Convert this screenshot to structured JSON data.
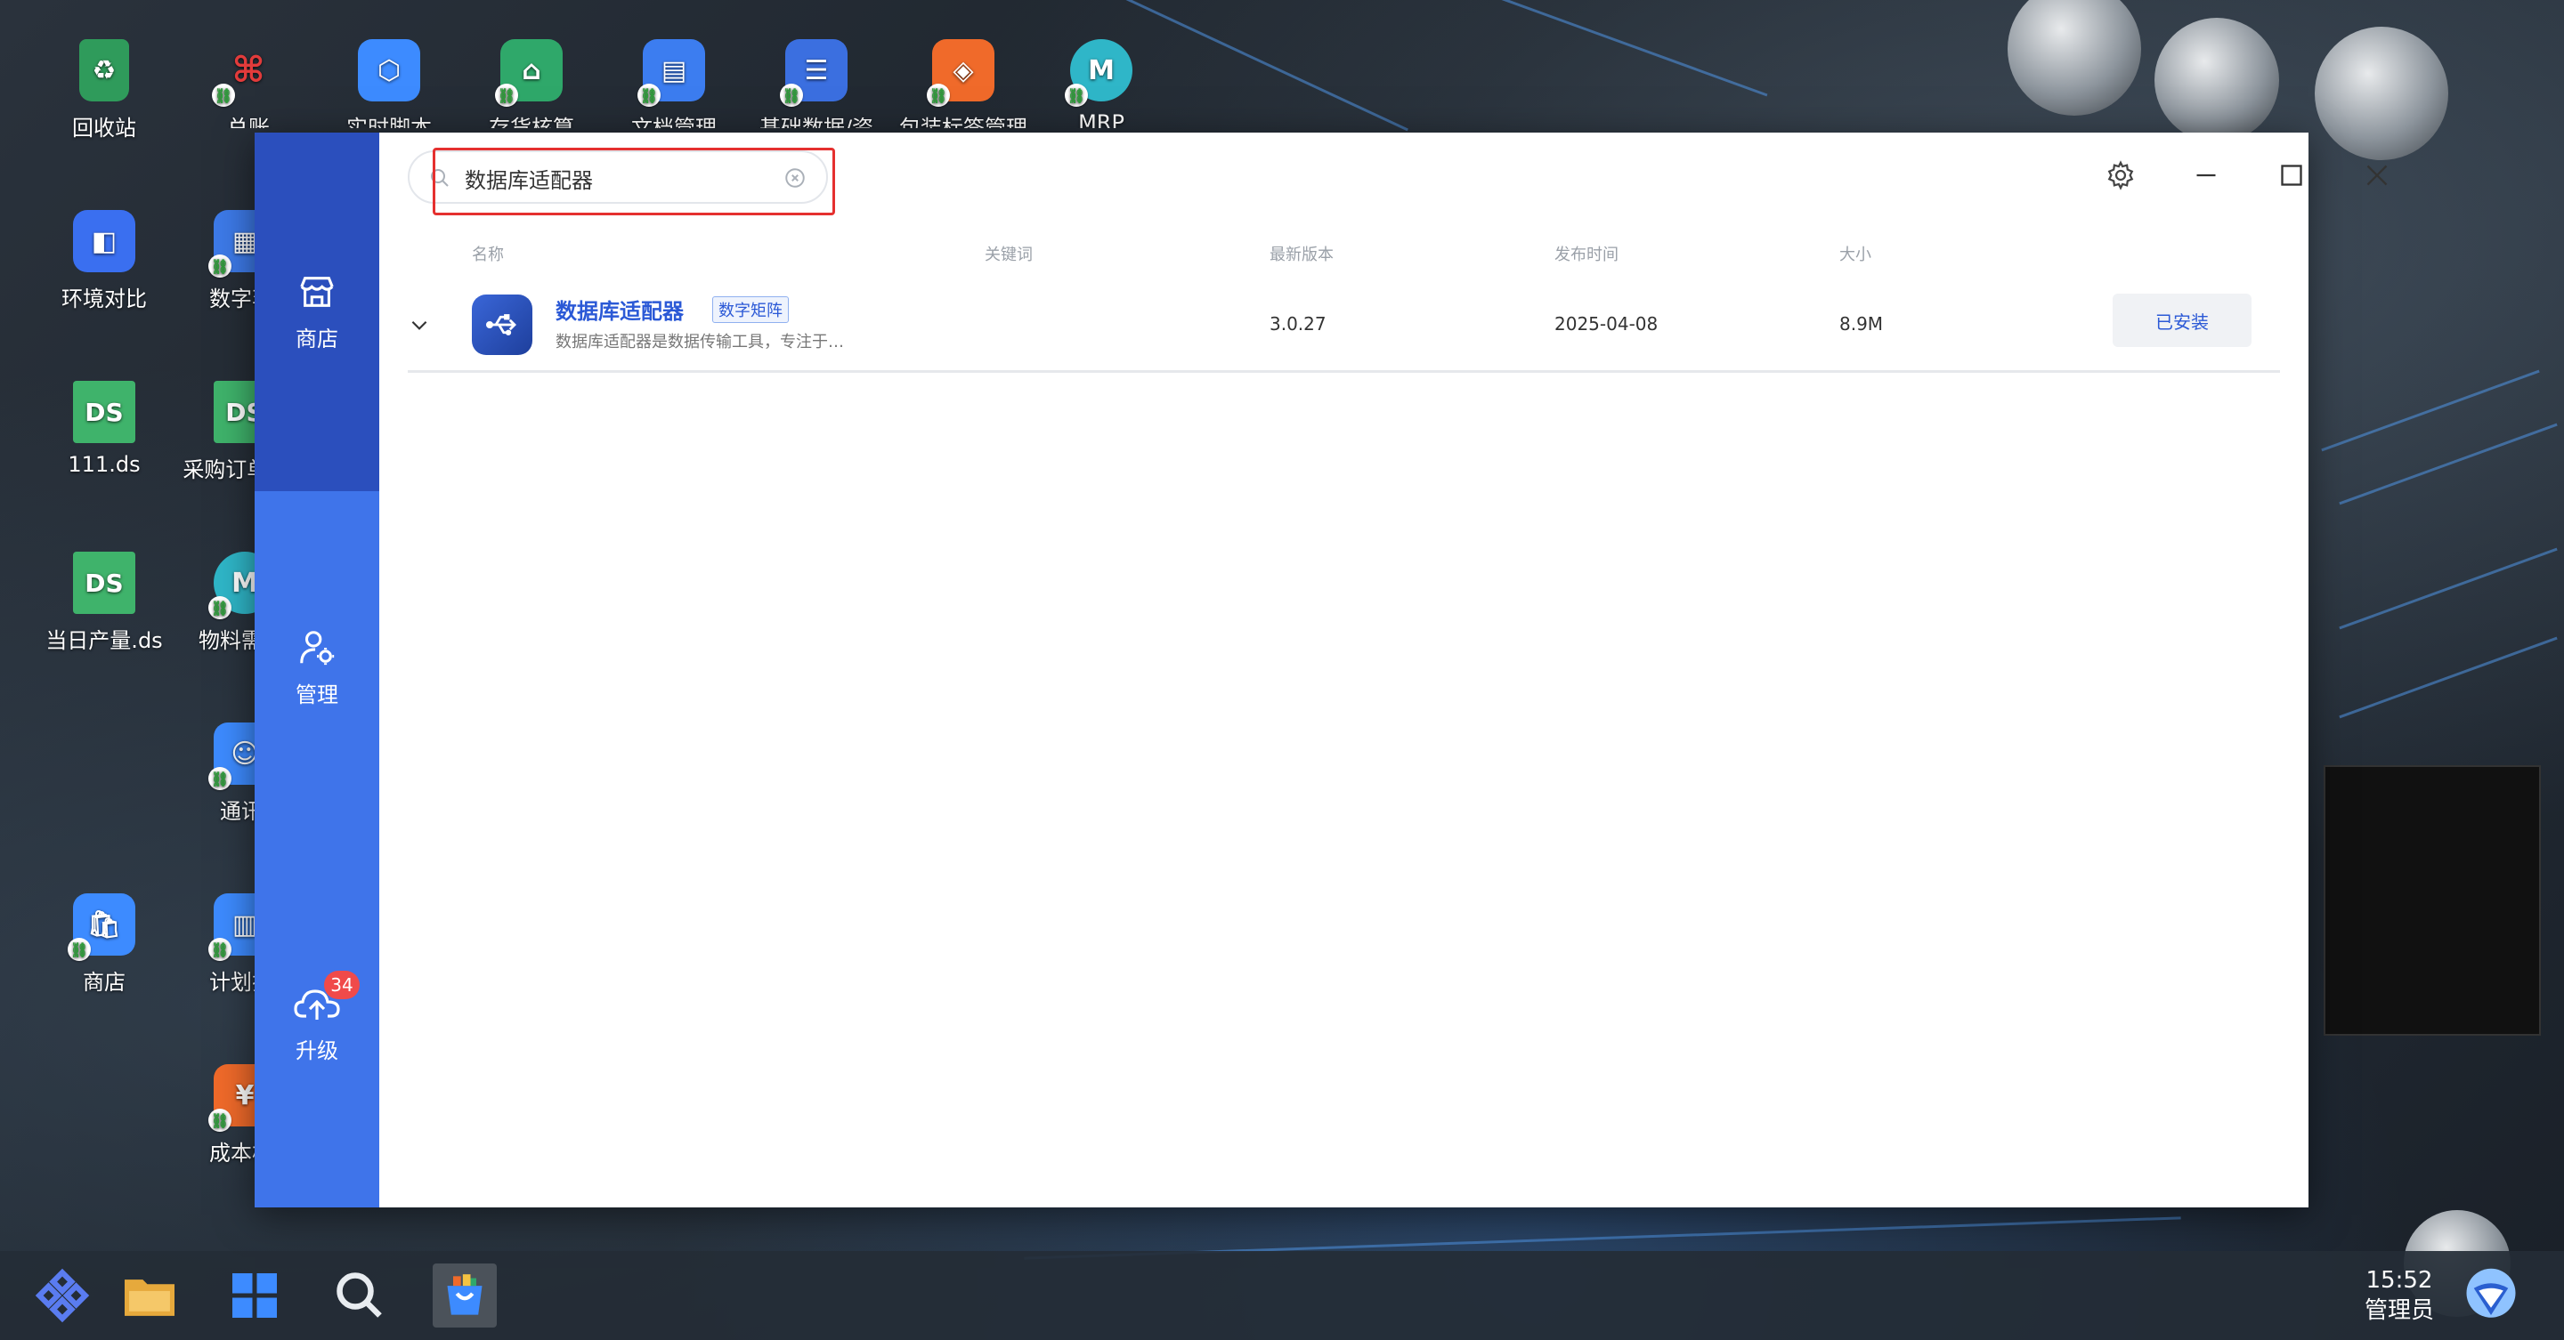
{
  "desktop": {
    "icons": [
      {
        "label": "回收站",
        "icon": "recycle-bin-icon",
        "color": "#2f9b5b"
      },
      {
        "label": "总账",
        "icon": "ledger-icon",
        "color": "#e23b3b"
      },
      {
        "label": "实时脚本",
        "icon": "cube-icon",
        "color": "#3d8bff"
      },
      {
        "label": "存货核算",
        "icon": "warehouse-icon",
        "color": "#2fa86a"
      },
      {
        "label": "文档管理",
        "icon": "document-icon",
        "color": "#3c7df0"
      },
      {
        "label": "基础数据/资",
        "icon": "data-icon",
        "color": "#3b6fe0"
      },
      {
        "label": "包装标签管理",
        "icon": "label-icon",
        "color": "#f06a2a"
      },
      {
        "label": "MRP",
        "icon": "mrp-icon",
        "color": "#2fb6c8"
      },
      {
        "label": "环境对比",
        "icon": "compare-icon",
        "color": "#3a6ff0"
      },
      {
        "label": "数字孪",
        "icon": "grid-icon",
        "color": "#3d7ae8"
      },
      {
        "label": "111.ds",
        "icon": "ds-file-icon",
        "color": "#3fb36b"
      },
      {
        "label": "采购订单.ds",
        "icon": "ds-file-icon",
        "color": "#3fb36b"
      },
      {
        "label": "当日产量.ds",
        "icon": "ds-file-icon",
        "color": "#3fb36b"
      },
      {
        "label": "物料需求",
        "icon": "mrp-icon",
        "color": "#2fb6c8"
      },
      {
        "label": "通讯",
        "icon": "contacts-icon",
        "color": "#3d8bff"
      },
      {
        "label": "商店",
        "icon": "store-bag-icon",
        "color": "#3d8bff"
      },
      {
        "label": "计划排",
        "icon": "plan-icon",
        "color": "#3d8bff"
      },
      {
        "label": "成本核",
        "icon": "cost-icon",
        "color": "#f06a2a"
      }
    ]
  },
  "sidebar": {
    "store_label": "商店",
    "manage_label": "管理",
    "upgrade_label": "升级",
    "upgrade_badge": "34"
  },
  "search": {
    "value": "数据库适配器",
    "placeholder": ""
  },
  "table": {
    "headers": {
      "name": "名称",
      "keyword": "关键词",
      "version": "最新版本",
      "date": "发布时间",
      "size": "大小"
    },
    "rows": [
      {
        "name": "数据库适配器",
        "tag": "数字矩阵",
        "desc": "数据库适配器是数据传输工具，专注于…",
        "version": "3.0.27",
        "date": "2025-04-08",
        "size": "8.9M",
        "action": "已安装"
      }
    ]
  },
  "taskbar": {
    "time": "15:52",
    "user": "管理员"
  },
  "colors": {
    "sidebar": "#3f74ea",
    "sidebar_active": "#2b4fbd",
    "accent": "#2b59d6",
    "highlight": "#e5302f"
  }
}
